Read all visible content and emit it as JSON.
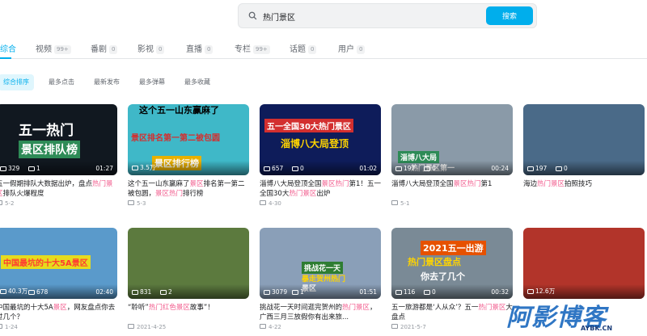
{
  "search": {
    "value": "热门景区",
    "button_label": "搜索"
  },
  "tabs": [
    {
      "label": "综合",
      "count": "",
      "active": true
    },
    {
      "label": "视频",
      "count": "99+"
    },
    {
      "label": "番剧",
      "count": "0"
    },
    {
      "label": "影视",
      "count": "0"
    },
    {
      "label": "直播",
      "count": "0"
    },
    {
      "label": "专栏",
      "count": "99+"
    },
    {
      "label": "话题",
      "count": "0"
    },
    {
      "label": "用户",
      "count": "0"
    }
  ],
  "sorts": [
    "综合排序",
    "最多点击",
    "最新发布",
    "最多弹幕",
    "最多收藏"
  ],
  "videos": [
    {
      "cover_bg": "#111820",
      "plays": "329",
      "danmaku": "1",
      "duration": "01:27",
      "overlay": [
        "五一热门",
        "景区排队榜"
      ],
      "title": [
        [
          "五一假期排队大数据出炉，盘点",
          ""
        ],
        [
          "热门景区",
          "h"
        ],
        [
          "排队火爆程度",
          ""
        ]
      ],
      "author": "",
      "date": "5-2"
    },
    {
      "cover_bg": "#3fb8c8",
      "plays": "3.5万",
      "danmaku": "",
      "duration": "",
      "overlay": [
        "这个五一山东赢麻了",
        "景区排名第一第二被包圆",
        "景区排行榜"
      ],
      "title": [
        [
          "这个五一山东赢麻了",
          ""
        ],
        [
          "景区",
          "h"
        ],
        [
          "排名第一第二被包圆，",
          ""
        ],
        [
          "景区热门",
          "h"
        ],
        [
          "排行榜",
          ""
        ]
      ],
      "author": "",
      "date": "5-3"
    },
    {
      "cover_bg": "#0e1c5a",
      "plays": "657",
      "danmaku": "0",
      "duration": "01:02",
      "overlay": [
        "五一全国30大热门景区",
        "淄博八大局登顶"
      ],
      "title": [
        [
          "淄博八大局登顶全国",
          ""
        ],
        [
          "景区热门",
          "h"
        ],
        [
          "第1！五一全国30大",
          ""
        ],
        [
          "热门景区",
          "h"
        ],
        [
          "出炉",
          ""
        ]
      ],
      "author": "",
      "date": "4-30"
    },
    {
      "cover_bg": "#8a9aa8",
      "plays": "197",
      "danmaku": "0",
      "duration": "00:24",
      "overlay": [
        "淄博八大局",
        "热门景区第一"
      ],
      "title": [
        [
          "淄博八大局登顶全国",
          ""
        ],
        [
          "景区热门",
          "h"
        ],
        [
          "第1",
          ""
        ]
      ],
      "author": "",
      "date": "5-1"
    },
    {
      "cover_bg": "#4a6a88",
      "plays": "197",
      "danmaku": "0",
      "duration": "",
      "overlay": [],
      "title": [
        [
          "海边",
          ""
        ],
        [
          "热门景区",
          "h"
        ],
        [
          "拍照技巧",
          ""
        ]
      ],
      "author": "",
      "date": ""
    },
    {
      "cover_bg": "#5a9acb",
      "plays": "40.3万",
      "danmaku": "678",
      "duration": "02:40",
      "overlay": [
        "中国最坑的十大5A景区"
      ],
      "title": [
        [
          "中国最坑的十大5A",
          ""
        ],
        [
          "景区",
          "h"
        ],
        [
          "，网友盘点",
          ""
        ],
        [
          "你去过几个？",
          ""
        ]
      ],
      "author": "",
      "date": "1-24"
    },
    {
      "cover_bg": "#5c7a3e",
      "plays": "831",
      "danmaku": "2",
      "duration": "",
      "overlay": [],
      "title": [
        [
          "“聆听”",
          ""
        ],
        [
          "热门红色景区",
          "h"
        ],
        [
          "故事”！",
          ""
        ]
      ],
      "author": "",
      "date": "2021-4-25"
    },
    {
      "cover_bg": "#8a9fb8",
      "plays": "3079",
      "danmaku": "1",
      "duration": "01:51",
      "overlay": [
        "挑战花一天",
        "暴走贺州热门",
        "景区"
      ],
      "title": [
        [
          "挑战花一天时间逛完贺州的",
          ""
        ],
        [
          "热门景区",
          "h"
        ],
        [
          "，广西三月三放假你有出来旅...",
          ""
        ]
      ],
      "author": "",
      "date": "4-22"
    },
    {
      "cover_bg": "#7a8a96",
      "plays": "116",
      "danmaku": "0",
      "duration": "00:32",
      "overlay": [
        "2021五一出游",
        "热门景区盘点",
        "你去了几个"
      ],
      "title": [
        [
          "五一旅游都是‘人从众’？五一",
          ""
        ],
        [
          "热门景区",
          "h"
        ],
        [
          "大盘点",
          ""
        ]
      ],
      "author": "",
      "date": "2021-5-7"
    },
    {
      "cover_bg": "#b2342a",
      "plays": "12.6万",
      "danmaku": "",
      "duration": "",
      "overlay": [],
      "title": [
        [
          "",
          ""
        ]
      ],
      "author": "",
      "date": ""
    }
  ],
  "watermark": {
    "main": "阿影博客",
    "sub": "AYBK.CN"
  },
  "colors": {
    "accent": "#00aeec",
    "highlight": "#f25d8e",
    "text": "#18191c",
    "muted": "#9499a0"
  }
}
